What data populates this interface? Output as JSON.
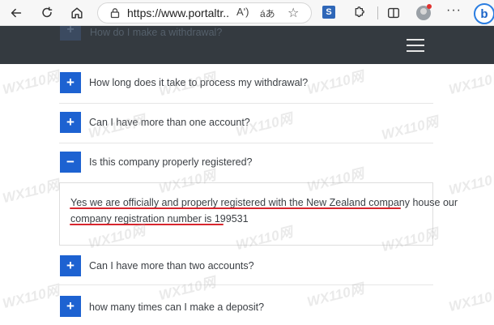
{
  "browser": {
    "url": "https://www.portaltr...",
    "read_aloud": "Aʹ)",
    "translate_glyph": "áあ",
    "favorite_glyph": "☆",
    "ext_label": "S",
    "more_label": "···",
    "bing_label": "b"
  },
  "header": {
    "partial_toggle": "+",
    "partial_question": "How do I make a withdrawal?"
  },
  "faq": [
    {
      "toggle": "+",
      "question": "How long does it take to process my withdrawal?"
    },
    {
      "toggle": "+",
      "question": "Can I have more than one account?"
    },
    {
      "toggle": "−",
      "question": "Is this company properly registered?"
    },
    {
      "toggle": "+",
      "question": "Can I have more than two accounts?"
    },
    {
      "toggle": "+",
      "question": "how many times can I make a deposit?"
    }
  ],
  "answer": {
    "line1": "Yes we are officially and properly registered with the New Zealand company house our",
    "line2": "company registration number is 199531"
  },
  "watermark": "WX110网",
  "colors": {
    "toggle_bg": "#1d62d1",
    "header_bg": "#343a40",
    "underline": "#d7262e"
  }
}
